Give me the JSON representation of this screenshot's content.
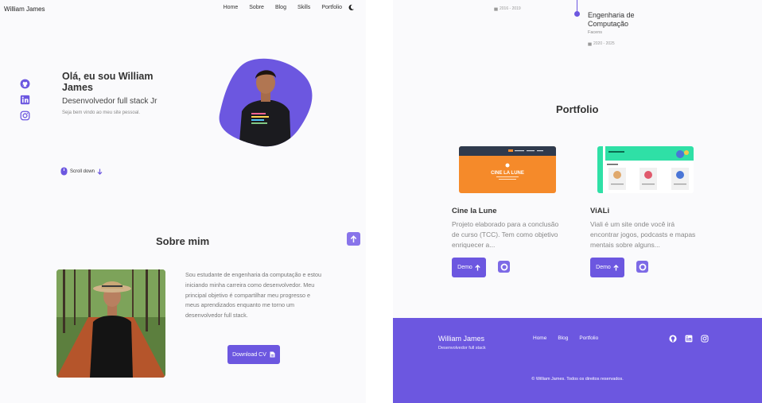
{
  "header": {
    "brand": "William James",
    "nav": [
      "Home",
      "Sobre",
      "Blog",
      "Skills",
      "Portfolio"
    ]
  },
  "hero": {
    "title": "Olá, eu sou William James",
    "subtitle": "Desenvolvedor full stack Jr",
    "description": "Seja bem vindo ao meu site pessoal.",
    "scroll_label": "Scroll down"
  },
  "about": {
    "title": "Sobre mim",
    "text": "Sou estudante de engenharia da computação e estou iniciando minha carreira como desenvolvedor. Meu principal objetivo é compartilhar meu progresso e meus aprendizados enquanto me torno um desenvolvedor full stack.",
    "cv_label": "Download CV"
  },
  "timeline": {
    "left_date": "2016 - 2019",
    "title": "Engenharia de Computação",
    "institution": "Facens",
    "date": "2020 - 2025"
  },
  "portfolio": {
    "title": "Portfolio",
    "projects": [
      {
        "title": "Cine la Lune",
        "description": "Projeto elaborado para a conclusão de curso (TCC). Tem como objetivo enriquecer a...",
        "demo_label": "Demo",
        "thumb_heading": "CINE LA LUNE"
      },
      {
        "title": "ViALi",
        "description": "Viali é um site onde você irá encontrar jogos, podcasts e mapas mentais sobre alguns...",
        "demo_label": "Demo"
      }
    ]
  },
  "footer": {
    "name": "William James",
    "role": "Desenvolvedor full stack",
    "links": [
      "Home",
      "Blog",
      "Portfolio"
    ],
    "copyright": "© William James. Todos os direitos reservados."
  },
  "colors": {
    "accent": "#6c57e0",
    "cine_orange": "#f58a2a",
    "viali_green": "#2fe0a6"
  }
}
